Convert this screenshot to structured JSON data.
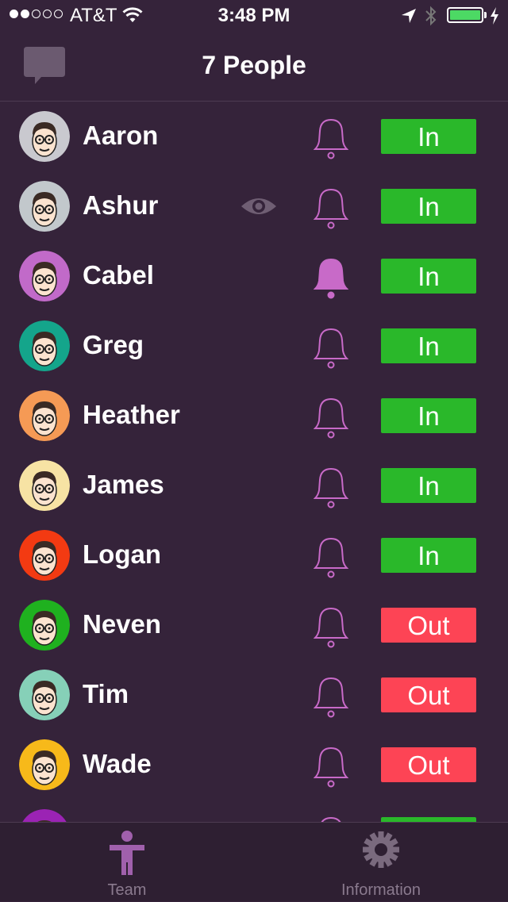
{
  "status_bar": {
    "carrier": "AT&T",
    "time": "3:48 PM",
    "signal_bars": 2,
    "signal_total": 5,
    "battery_level": 1.0,
    "battery_color": "#4cd964"
  },
  "header": {
    "title": "7 People",
    "chat_icon": "chat-bubble-icon"
  },
  "people": [
    {
      "name": "Aaron",
      "status": "In",
      "bell_active": false,
      "eye": false,
      "avatar_bg": "#c9c9cf"
    },
    {
      "name": "Ashur",
      "status": "In",
      "bell_active": false,
      "eye": true,
      "avatar_bg": "#c2c8cc"
    },
    {
      "name": "Cabel",
      "status": "In",
      "bell_active": true,
      "eye": false,
      "avatar_bg": "#c16ac9"
    },
    {
      "name": "Greg",
      "status": "In",
      "bell_active": false,
      "eye": false,
      "avatar_bg": "#14a58b"
    },
    {
      "name": "Heather",
      "status": "In",
      "bell_active": false,
      "eye": false,
      "avatar_bg": "#f59a55"
    },
    {
      "name": "James",
      "status": "In",
      "bell_active": false,
      "eye": false,
      "avatar_bg": "#f7e3a4"
    },
    {
      "name": "Logan",
      "status": "In",
      "bell_active": false,
      "eye": false,
      "avatar_bg": "#f33a12"
    },
    {
      "name": "Neven",
      "status": "Out",
      "bell_active": false,
      "eye": false,
      "avatar_bg": "#1fb11f"
    },
    {
      "name": "Tim",
      "status": "Out",
      "bell_active": false,
      "eye": false,
      "avatar_bg": "#86d0b8"
    },
    {
      "name": "Wade",
      "status": "Out",
      "bell_active": false,
      "eye": false,
      "avatar_bg": "#f7b91a"
    },
    {
      "name": "",
      "status": "",
      "bell_active": false,
      "eye": false,
      "avatar_bg": "#9b23b4"
    }
  ],
  "tabs": [
    {
      "label": "Team",
      "icon": "person-icon",
      "active": true
    },
    {
      "label": "Information",
      "icon": "gear-icon",
      "active": false
    }
  ],
  "colors": {
    "background": "#35233a",
    "in": "#2ab82a",
    "out": "#fd4455",
    "bell": "#c86ac8",
    "eye": "#6f5e73",
    "tab_active_icon": "#a060ac",
    "tab_inactive_icon": "#7a6a7e"
  }
}
